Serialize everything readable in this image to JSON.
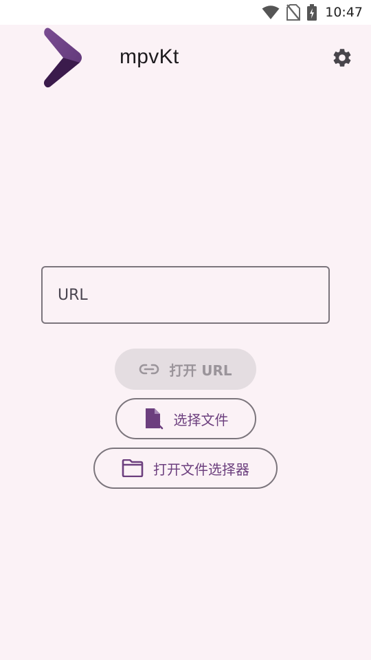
{
  "status_bar": {
    "time": "10:47",
    "icons": [
      "wifi-icon",
      "no-sim-icon",
      "battery-icon"
    ]
  },
  "header": {
    "app_title": "mpvKt",
    "logo": "mpvkt-logo",
    "settings_icon": "gear-icon"
  },
  "url_input": {
    "placeholder": "URL",
    "value": ""
  },
  "actions": {
    "open_url_label": "打开 URL",
    "open_url_icon": "link-icon",
    "open_url_enabled": false,
    "pick_file_label": "选择文件",
    "pick_file_icon": "file-open-icon",
    "file_picker_label": "打开文件选择器",
    "file_picker_icon": "folder-icon"
  },
  "colors": {
    "background": "#fbf2f6",
    "accent": "#6c3f7e",
    "outline": "#7b757c",
    "disabled_bg": "#e4dde1",
    "disabled_text": "#9a949a"
  }
}
